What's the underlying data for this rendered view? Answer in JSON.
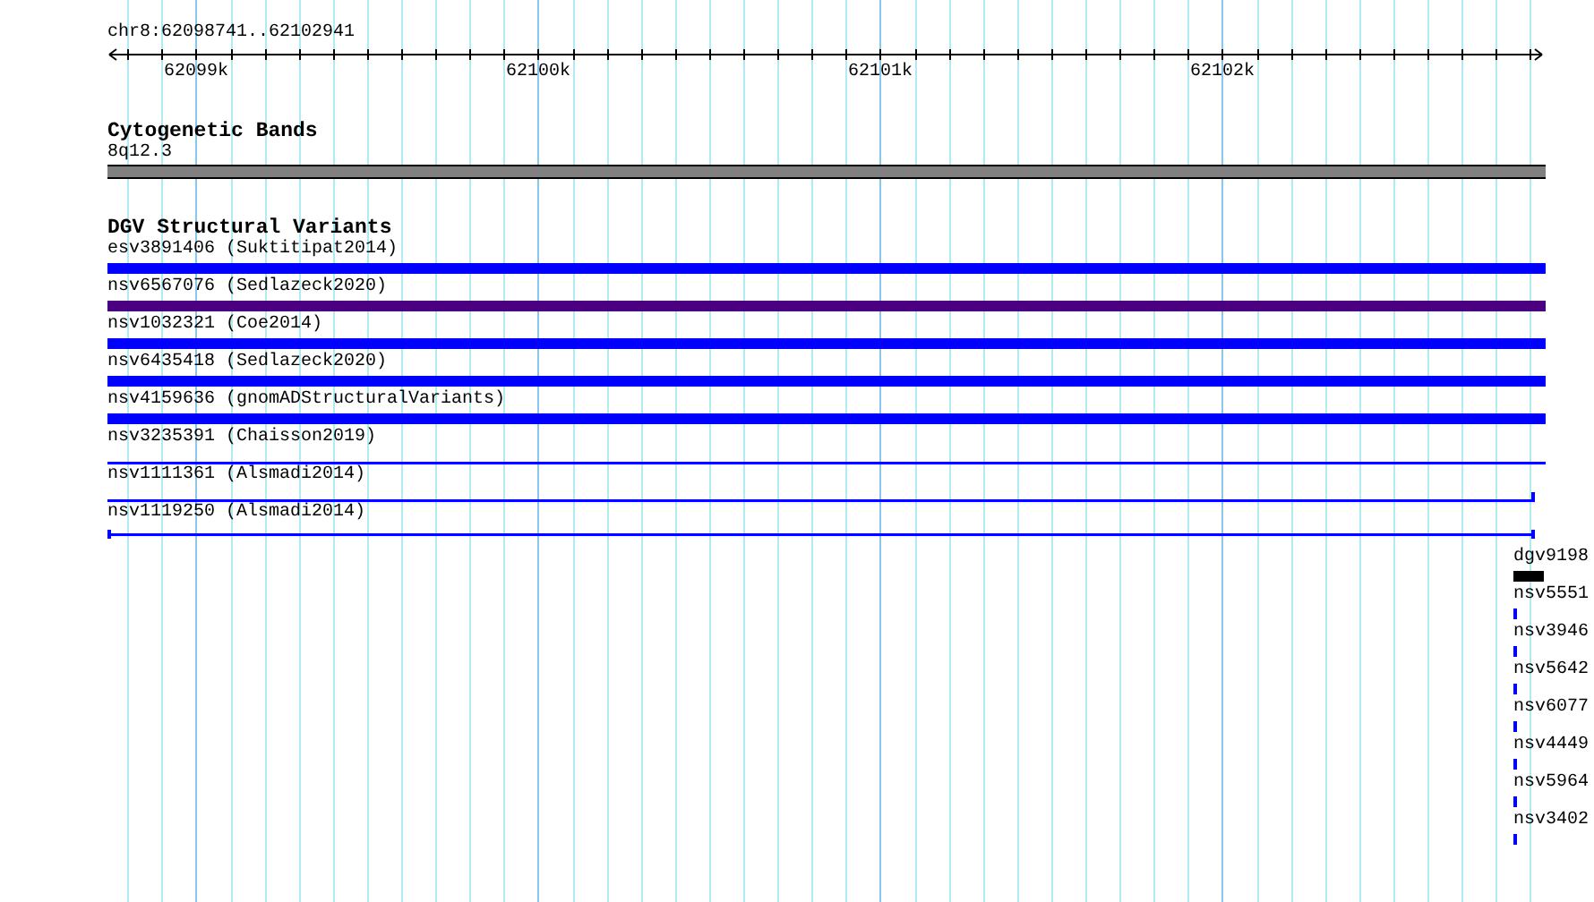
{
  "ruler": {
    "location": "chr8:62098741..62102941",
    "tick_labels": [
      "62099k",
      "62100k",
      "62101k",
      "62102k"
    ]
  },
  "tracks": [
    {
      "title": "Cytogenetic Bands",
      "kind": "bands",
      "features": [
        {
          "label": "8q12.3"
        }
      ]
    },
    {
      "title": "DGV Structural Variants",
      "kind": "variants",
      "features": [
        {
          "label": "esv3891406 (Suktitipat2014)",
          "kind": "thick",
          "color": "#0000ff"
        },
        {
          "label": "nsv6567076 (Sedlazeck2020)",
          "kind": "thick",
          "color": "#4b0082"
        },
        {
          "label": "nsv1032321 (Coe2014)",
          "kind": "thick",
          "color": "#0000ff"
        },
        {
          "label": "nsv6435418 (Sedlazeck2020)",
          "kind": "thick",
          "color": "#0000ff"
        },
        {
          "label": "nsv4159636 (gnomADStructuralVariants)",
          "kind": "thick",
          "color": "#0000ff"
        },
        {
          "label": "nsv3235391 (Chaisson2019)",
          "kind": "line",
          "color": "#0000ff",
          "start_cap": false,
          "end_cap": false
        },
        {
          "label": "nsv1111361 (Alsmadi2014)",
          "kind": "line",
          "color": "#0000ff",
          "start_cap": false,
          "end_cap": true
        },
        {
          "label": "nsv1119250 (Alsmadi2014)",
          "kind": "line",
          "color": "#0000ff",
          "start_cap": true,
          "end_cap": true
        }
      ]
    }
  ],
  "edge_features": [
    {
      "label": "dgv9198",
      "kind": "block",
      "color": "#000000"
    },
    {
      "label": "nsv5551",
      "kind": "dash",
      "color": "#0000ff"
    },
    {
      "label": "nsv3946",
      "kind": "dash",
      "color": "#0000ff"
    },
    {
      "label": "nsv5642",
      "kind": "dash",
      "color": "#0000ff"
    },
    {
      "label": "nsv6077",
      "kind": "dash",
      "color": "#0000ff"
    },
    {
      "label": "nsv4449",
      "kind": "dash",
      "color": "#0000ff"
    },
    {
      "label": "nsv5964",
      "kind": "dash",
      "color": "#0000ff"
    },
    {
      "label": "nsv3402",
      "kind": "dash",
      "color": "#0000ff"
    }
  ]
}
